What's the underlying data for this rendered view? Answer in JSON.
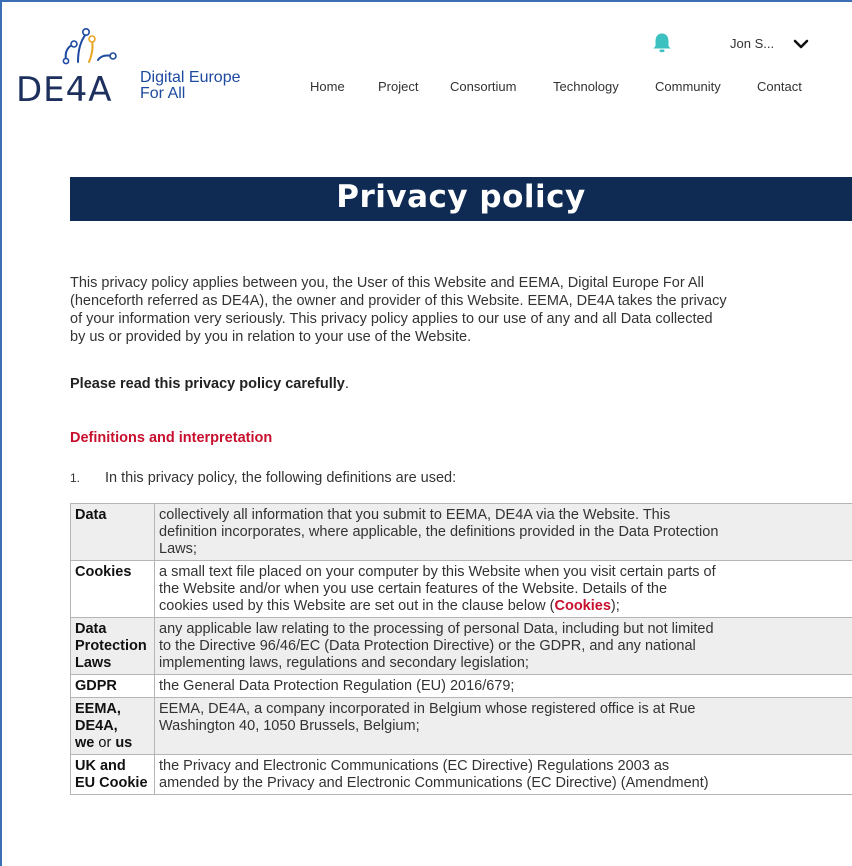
{
  "header": {
    "logo_text_line1": "Digital Europe",
    "logo_text_line2": "For All",
    "logo_mark": "DE4A",
    "user_name": "Jon S...",
    "nav": [
      "Home",
      "Project",
      "Consortium",
      "Technology",
      "Community",
      "Contact"
    ]
  },
  "banner": {
    "title": "Privacy policy"
  },
  "intro": {
    "line1": "This privacy policy applies between you, the User of this Website and EEMA, Digital Europe For All",
    "line2": "(henceforth referred as DE4A), the owner and provider of this Website. EEMA, DE4A takes the privacy",
    "line3": "of your information very seriously. This privacy policy applies to our use of any and all Data collected",
    "line4": "by us or provided by you in relation to your use of the Website."
  },
  "careful": {
    "text": "Please read this privacy policy carefully",
    "dot": "."
  },
  "definitions": {
    "heading": "Definitions and interpretation",
    "item_number": "1.",
    "item_text": "In this privacy policy, the following definitions are used:",
    "rows": [
      {
        "term_lines": [
          "Data"
        ],
        "desc_lines": [
          "collectively all information that you submit to EEMA, DE4A via the Website. This",
          "definition incorporates, where applicable, the definitions provided in the Data Protection",
          "Laws;"
        ]
      },
      {
        "term_lines": [
          "Cookies"
        ],
        "desc_lines": [
          "a small text file placed on your computer by this Website when you visit certain parts of",
          "the Website and/or when you use certain features of the Website. Details of the",
          "cookies used by this Website are set out in the clause below ("
        ],
        "desc_link": "Cookies",
        "desc_tail": ");"
      },
      {
        "term_lines": [
          "Data",
          "Protection",
          "Laws"
        ],
        "desc_lines": [
          "any applicable law relating to the processing of personal Data, including but not limited",
          "to the Directive 96/46/EC (Data Protection Directive) or the GDPR, and any national",
          "implementing laws, regulations and secondary legislation;"
        ]
      },
      {
        "term_lines": [
          "GDPR"
        ],
        "desc_lines": [
          "the General Data Protection Regulation (EU) 2016/679;"
        ]
      },
      {
        "term_lines": [
          "EEMA,",
          "DE4A,",
          "we",
          "or",
          "us"
        ],
        "desc_lines": [
          "EEMA, DE4A, a company incorporated in Belgium whose registered office is at Rue",
          "Washington 40, 1050 Brussels, Belgium;"
        ]
      },
      {
        "term_lines": [
          "UK and",
          "EU Cookie"
        ],
        "desc_lines": [
          "the Privacy and Electronic Communications (EC Directive) Regulations 2003 as",
          "amended by the Privacy and Electronic Communications (EC Directive) (Amendment)"
        ]
      }
    ]
  },
  "colors": {
    "banner": "#0f2b54",
    "accent_red": "#c8102e",
    "logo_blue": "#1e4aa0",
    "bell": "#3cc0c0"
  },
  "icons": {
    "bell": "bell-icon",
    "chevron": "chevron-down-icon",
    "logo": "de4a-logo-icon"
  }
}
